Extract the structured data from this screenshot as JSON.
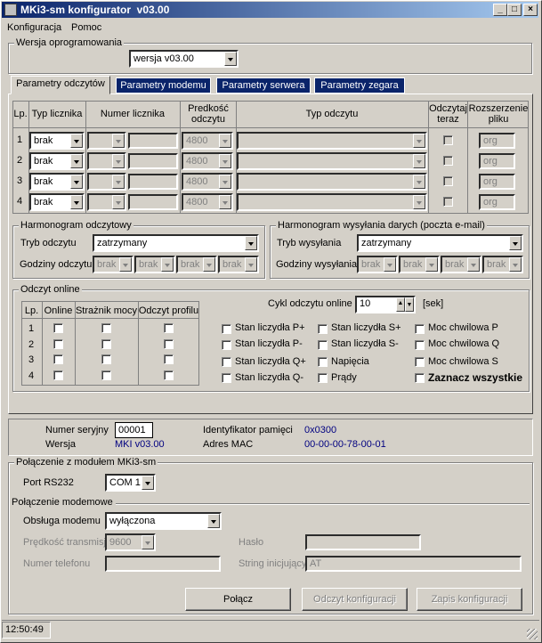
{
  "title": "MKi3-sm konfigurator  v03.00",
  "menu": [
    "Konfiguracja",
    "Pomoc"
  ],
  "version_group": {
    "title": "Wersja oprogramowania",
    "value": "wersja v03.00"
  },
  "tabs": [
    "Parametry odczytów",
    "Parametry modemu",
    "Parametry serwera",
    "Parametry zegara"
  ],
  "readings_table": {
    "headers": {
      "lp": "Lp.",
      "typ": "Typ licznika",
      "numer": "Numer licznika",
      "predkosc": "Predkość odczytu",
      "typ_odczytu": "Typ odczytu",
      "odczytaj": "Odczytaj teraz",
      "rozszerzenie": "Rozszerzenie pliku"
    },
    "rows": [
      {
        "lp": "1",
        "typ": "brak",
        "predkosc": "4800",
        "ext": "org"
      },
      {
        "lp": "2",
        "typ": "brak",
        "predkosc": "4800",
        "ext": "org"
      },
      {
        "lp": "3",
        "typ": "brak",
        "predkosc": "4800",
        "ext": "org"
      },
      {
        "lp": "4",
        "typ": "brak",
        "predkosc": "4800",
        "ext": "org"
      }
    ]
  },
  "harm_odczytowy": {
    "title": "Harmonogram odczytowy",
    "tryb_label": "Tryb odczytu",
    "tryb_value": "zatrzymany",
    "godziny_label": "Godziny odczytu",
    "godziny": [
      "brak",
      "brak",
      "brak",
      "brak"
    ]
  },
  "harm_wysylania": {
    "title": "Harmonogram wysyłania darych (poczta e-mail)",
    "tryb_label": "Tryb wysyłania",
    "tryb_value": "zatrzymany",
    "godziny_label": "Godziny wysyłania",
    "godziny": [
      "brak",
      "brak",
      "brak",
      "brak"
    ]
  },
  "online": {
    "title": "Odczyt online",
    "headers": {
      "lp": "Lp.",
      "online": "Online",
      "straznik": "Strażnik mocy",
      "profil": "Odczyt profilu"
    },
    "rows": [
      "1",
      "2",
      "3",
      "4"
    ],
    "cykl_label": "Cykl odczytu online",
    "cykl_value": "10",
    "cykl_unit": "[sek]",
    "checks": [
      "Stan liczydła P+",
      "Stan liczydła P-",
      "Stan liczydła Q+",
      "Stan liczydła Q-",
      "Stan liczydła S+",
      "Stan liczydła S-",
      "Napięcia",
      "Prądy",
      "Moc chwilowa P",
      "Moc chwilowa Q",
      "Moc chwilowa S",
      "Zaznacz wszystkie"
    ]
  },
  "info": {
    "numer_label": "Numer seryjny",
    "numer_value": "00001",
    "wersja_label": "Wersja",
    "wersja_value": "MKI v03.00",
    "id_label": "Identyfikator pamięci",
    "id_value": "0x0300",
    "mac_label": "Adres MAC",
    "mac_value": "00-00-00-78-00-01"
  },
  "polaczenie": {
    "title": "Połączenie z modułem MKi3-sm",
    "port_label": "Port RS232",
    "port_value": "COM 1",
    "modem_title": "Połączenie modemowe",
    "obsluga_label": "Obsługa modemu",
    "obsluga_value": "wyłączona",
    "predkosc_label": "Prędkość transmisji",
    "predkosc_value": "9600",
    "haslo_label": "Hasło",
    "telefon_label": "Numer telefonu",
    "string_label": "String inicjujący",
    "string_value": "AT"
  },
  "buttons": {
    "polacz": "Połącz",
    "odczyt": "Odczyt konfiguracji",
    "zapis": "Zapis konfiguracji"
  },
  "status": {
    "time": "12:50:49"
  }
}
